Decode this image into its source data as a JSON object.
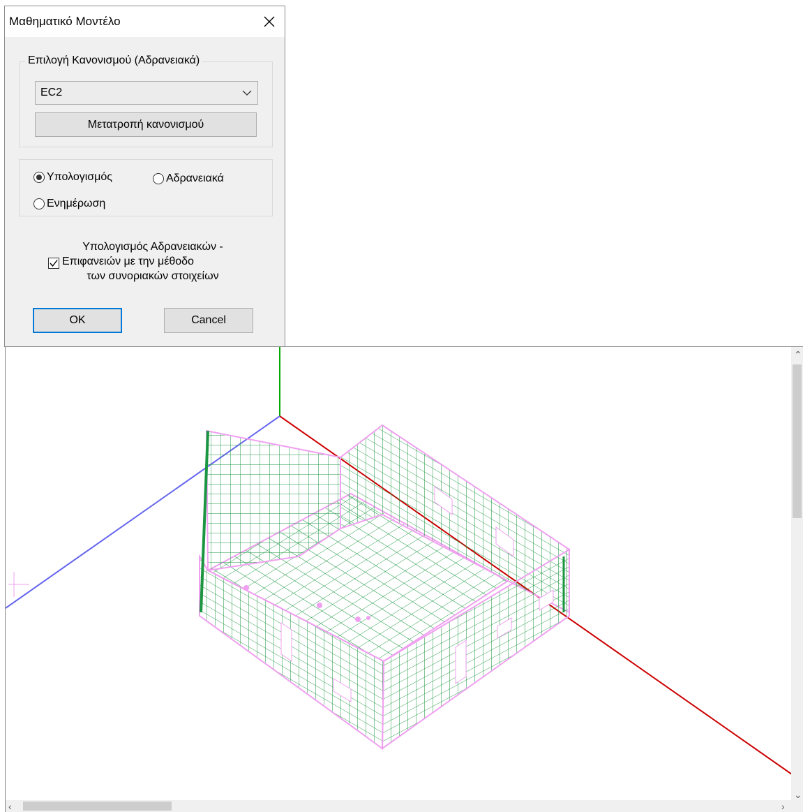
{
  "dialog": {
    "title": "Μαθηματικό Μοντέλο",
    "code_group": {
      "legend": "Επιλογή Κανονισμού (Αδρανειακά)",
      "selected": "EC2",
      "convert_button": "Μετατροπή κανονισμού"
    },
    "mode": {
      "options": [
        "Υπολογισμός",
        "Αδρανειακά",
        "Ενημέρωση"
      ],
      "selected": "Υπολογισμός"
    },
    "checkbox": {
      "checked": true,
      "lines": [
        "Υπολογισμός Αδρανειακών -",
        "Επιφανειών με την μέθοδο",
        "των συνοριακών στοιχείων"
      ]
    },
    "ok_label": "OK",
    "cancel_label": "Cancel"
  },
  "viewport": {
    "axis_colors": {
      "x": "#cc0000",
      "y": "#00aa00",
      "z": "#6666ee"
    },
    "mesh_color": "#1a9640",
    "node_color": "#f0a0f0"
  }
}
